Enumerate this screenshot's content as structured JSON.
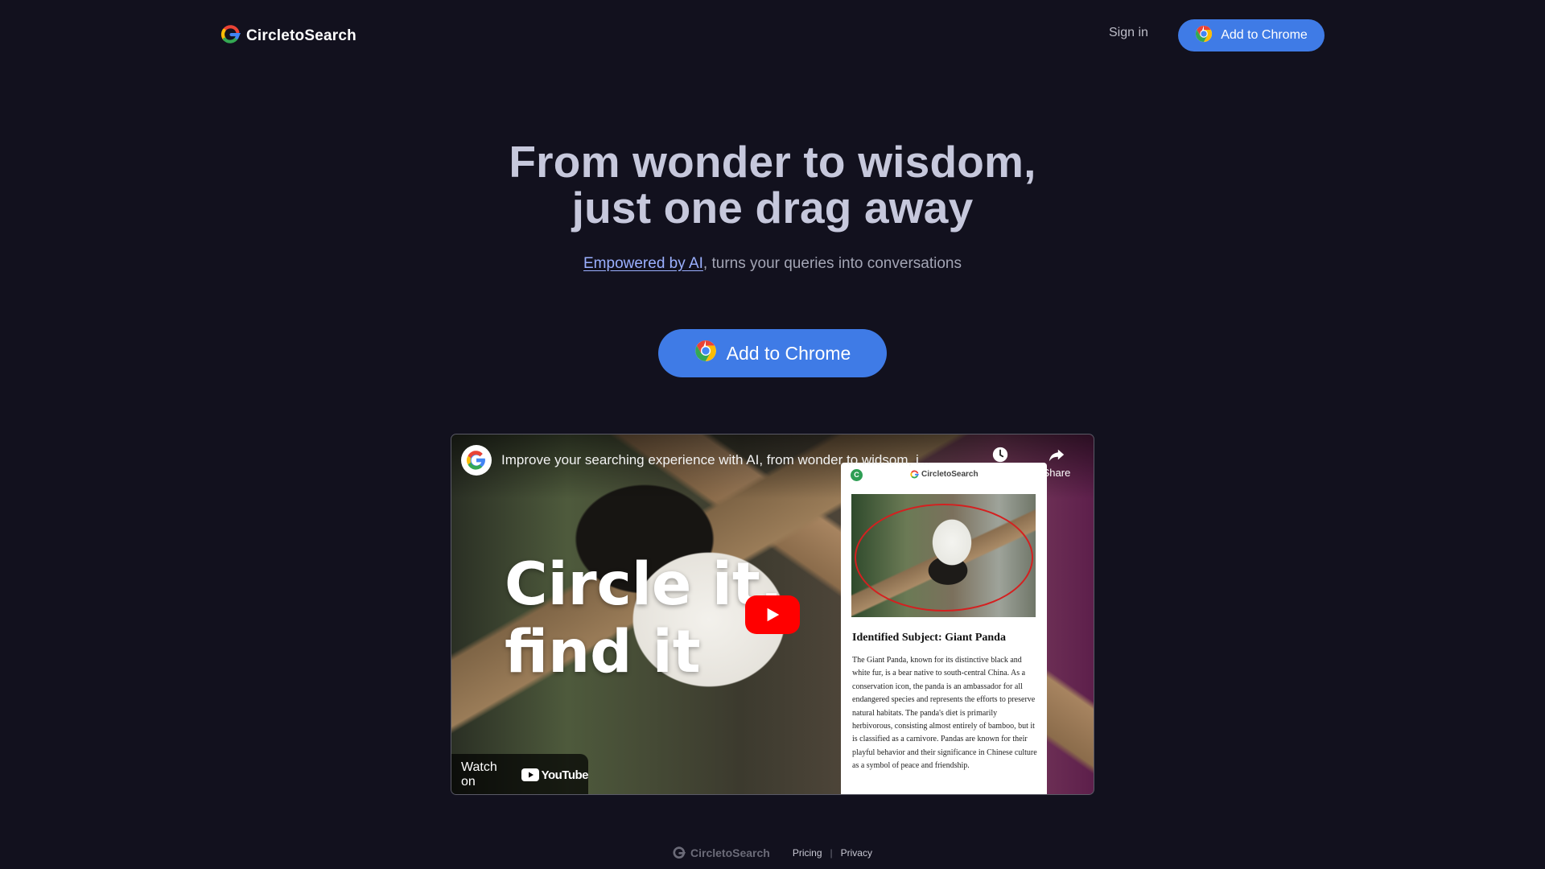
{
  "header": {
    "brand": "CircletoSearch",
    "signin_label": "Sign in",
    "cta_label": "Add to Chrome"
  },
  "hero": {
    "title_line1": "From wonder to wisdom,",
    "title_line2": "just one drag away",
    "subtitle_link": "Empowered by AI",
    "subtitle_rest": ", turns your queries into conversations",
    "cta_label": "Add to Chrome"
  },
  "video": {
    "title": "Improve your searching experience with AI, from wonder to widsom, i...",
    "watch_later_label": "Watch later",
    "share_label": "Share",
    "overlay_line1": "Circle it,",
    "overlay_line2": "find it",
    "watch_on_label": "Watch on",
    "youtube_label": "YouTube",
    "popup": {
      "dot_letter": "C",
      "brand": "CircletoSearch",
      "heading": "Identified Subject: Giant Panda",
      "body": "The Giant Panda, known for its distinctive black and white fur, is a bear native to south-central China. As a conservation icon, the panda is an ambassador for all endangered species and represents the efforts to preserve natural habitats. The panda's diet is primarily herbivorous, consisting almost entirely of bamboo, but it is classified as a carnivore. Pandas are known for their playful behavior and their significance in Chinese culture as a symbol of peace and friendship."
    }
  },
  "footer": {
    "brand": "CircletoSearch",
    "links": [
      "Pricing",
      "Privacy"
    ],
    "separator": "|"
  },
  "colors": {
    "background": "#12111e",
    "accent": "#3f7be6",
    "link": "#9bb0ff",
    "youtube_red": "#ff0000"
  },
  "icons": [
    "circletosearch-logo-icon",
    "chrome-icon",
    "clock-icon",
    "share-icon",
    "play-icon",
    "youtube-icon",
    "google-avatar-icon"
  ]
}
